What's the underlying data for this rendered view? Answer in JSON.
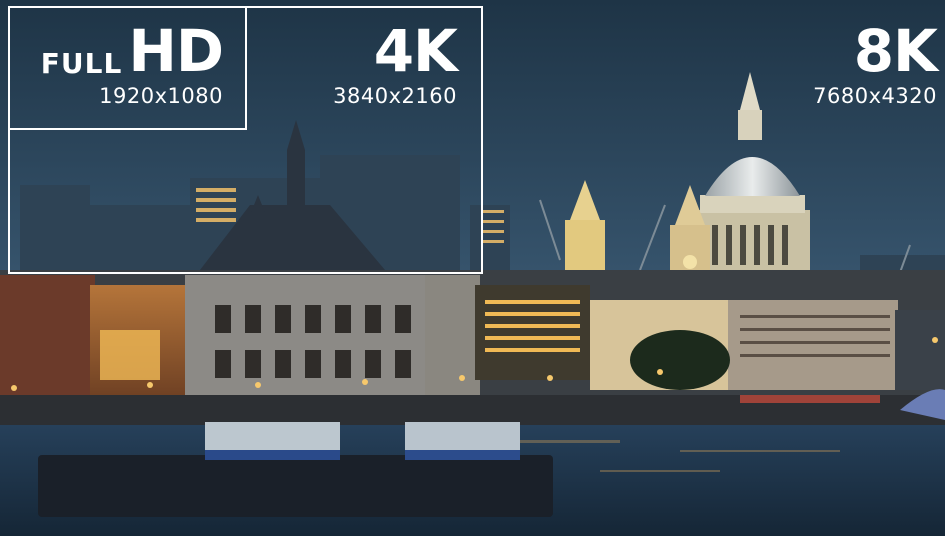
{
  "labels": {
    "fullhd": {
      "prefix": "FULL",
      "title": "HD",
      "resolution": "1920x1080"
    },
    "uhd4k": {
      "title": "4K",
      "resolution": "3840x2160"
    },
    "uhd8k": {
      "title": "8K",
      "resolution": "7680x4320"
    }
  },
  "colors": {
    "frame": "#ffffff",
    "sky_top": "#22394f",
    "sky_bottom": "#3d5c78",
    "water": "#1f3448",
    "city_lights": "#f3b04a"
  }
}
